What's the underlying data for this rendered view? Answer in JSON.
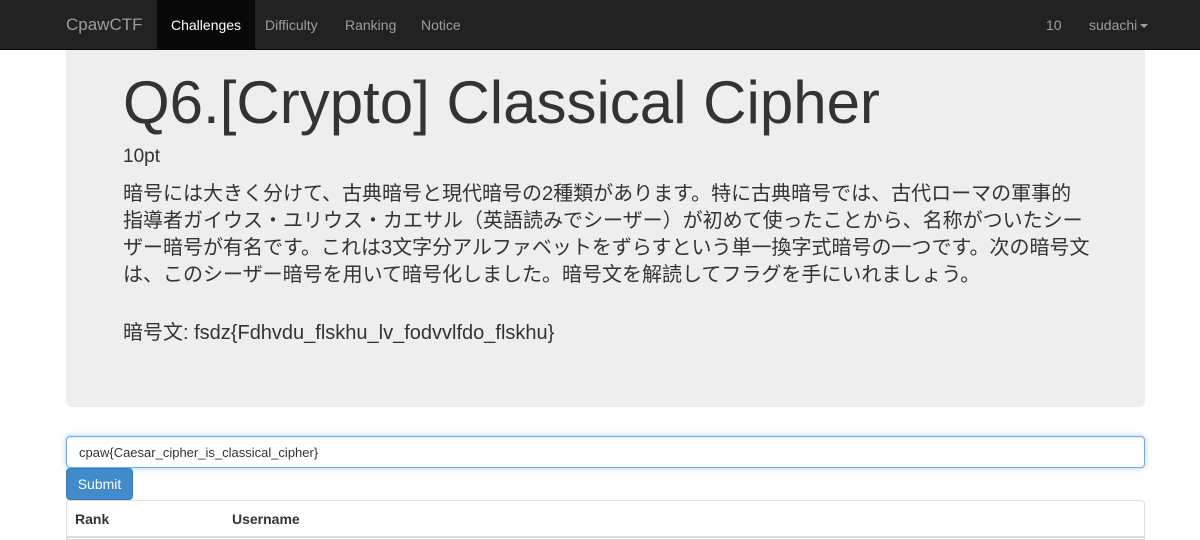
{
  "navbar": {
    "brand": "CpawCTF",
    "items": [
      {
        "label": "Challenges"
      },
      {
        "label": "Difficulty"
      },
      {
        "label": "Ranking"
      },
      {
        "label": "Notice"
      }
    ],
    "score": "10",
    "user": "sudachi"
  },
  "challenge": {
    "title": "Q6.[Crypto] Classical Cipher",
    "points": "10pt",
    "description": "暗号には大きく分けて、古典暗号と現代暗号の2種類があります。特に古典暗号では、古代ローマの軍事的指導者ガイウス・ユリウス・カエサル（英語読みでシーザー）が初めて使ったことから、名称がついたシーザー暗号が有名です。これは3文字分アルファベットをずらすという単一換字式暗号の一つです。次の暗号文は、このシーザー暗号を用いて暗号化しました。暗号文を解読してフラグを手にいれましょう。",
    "ciphertext": "暗号文: fsdz{Fdhvdu_flskhu_lv_fodvvlfdo_flskhu}"
  },
  "form": {
    "flag_value": "cpaw{Caesar_cipher_is_classical_cipher}",
    "submit_label": "Submit"
  },
  "table": {
    "headers": [
      "Rank",
      "Username"
    ]
  },
  "colors": {
    "navbar_bg": "#222222",
    "jumbotron_bg": "#eeeeee",
    "primary": "#428bca"
  }
}
